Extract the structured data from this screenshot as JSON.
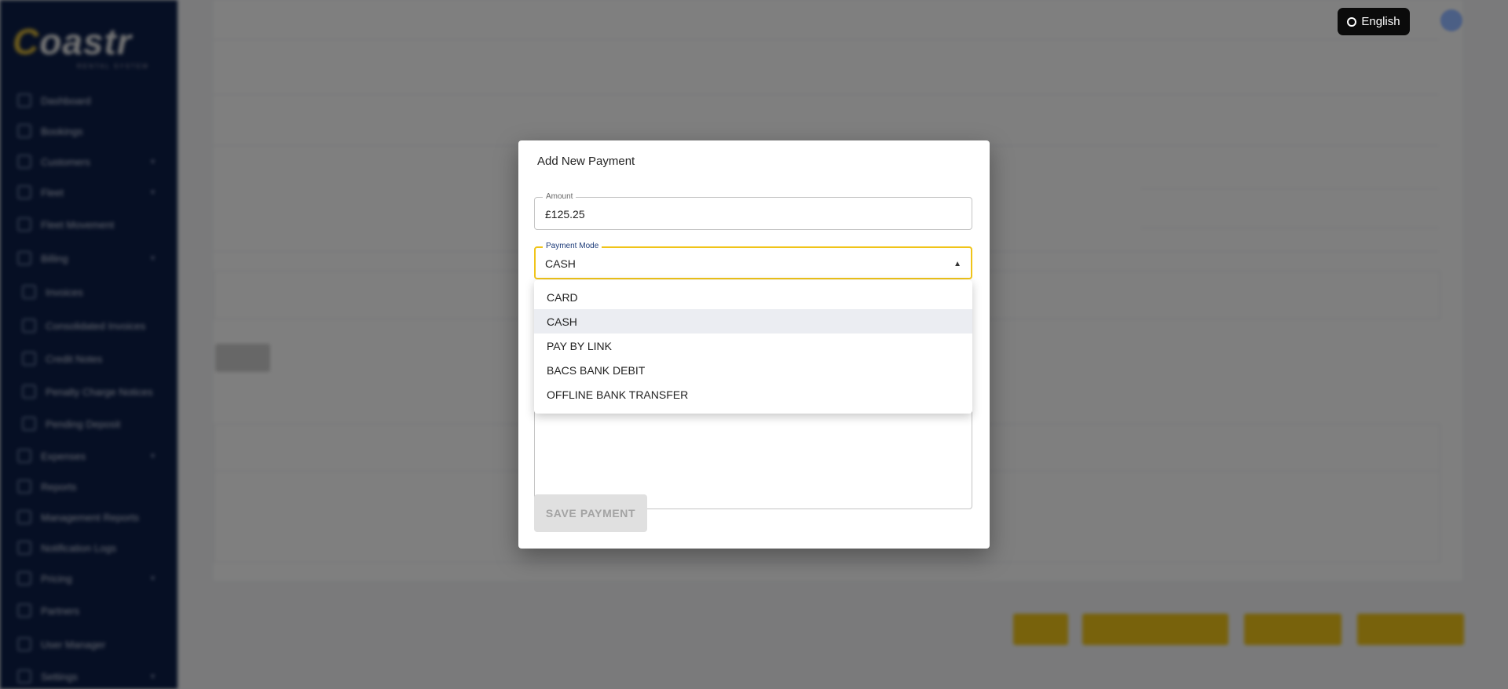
{
  "app": {
    "logo": "Coastr",
    "logo_sub": "RENTAL SYSTEM",
    "language_label": "English",
    "sidebar": [
      "Dashboard",
      "Bookings",
      "Customers",
      "Fleet",
      "Fleet Movement",
      "Billing",
      "Invoices",
      "Consolidated Invoices",
      "Credit Notes",
      "Penalty Charge Notices",
      "Pending Deposit",
      "Expenses",
      "Reports",
      "Management Reports",
      "Notification Logs",
      "Pricing",
      "Partners",
      "User Manager",
      "Settings"
    ]
  },
  "modal": {
    "title": "Add New Payment",
    "amount": {
      "label": "Amount",
      "value": "£125.25"
    },
    "payment_mode": {
      "label": "Payment Mode",
      "value": "CASH",
      "options": [
        "CARD",
        "CASH",
        "PAY BY LINK",
        "BACS BANK DEBIT",
        "OFFLINE BANK TRANSFER"
      ],
      "selected_index": 1
    },
    "save_label": "SAVE PAYMENT"
  },
  "colors": {
    "accent": "#f0c419",
    "sidebar": "#0c1e48",
    "label_focus": "#1b3a78"
  }
}
